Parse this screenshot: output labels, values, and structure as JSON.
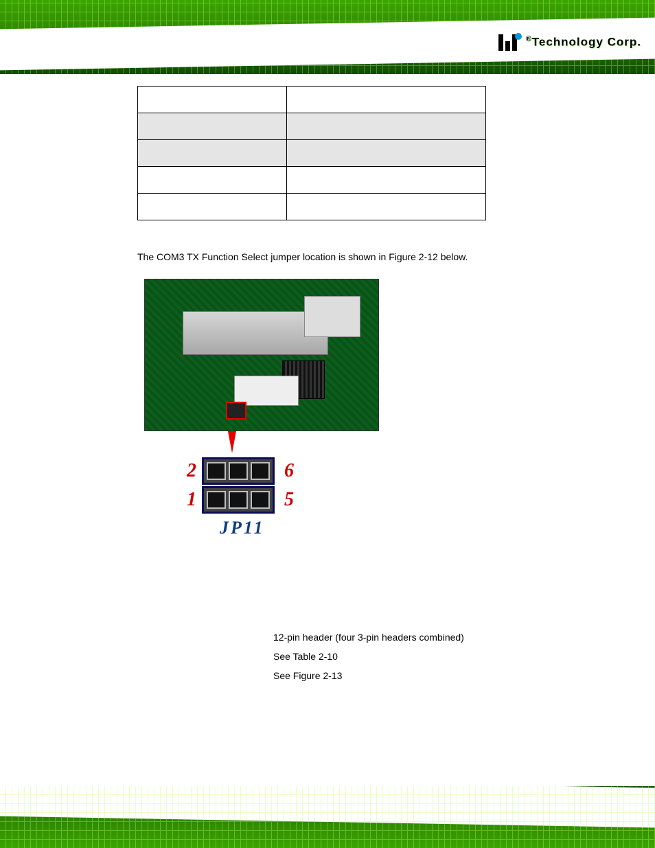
{
  "header": {
    "brand_text": "Technology Corp.",
    "registered": "®"
  },
  "table_rows": [
    {
      "shade": false,
      "left": "",
      "right": ""
    },
    {
      "shade": true,
      "left": "",
      "right": ""
    },
    {
      "shade": true,
      "left": "",
      "right": ""
    },
    {
      "shade": false,
      "left": "",
      "right": ""
    },
    {
      "shade": false,
      "left": "",
      "right": ""
    }
  ],
  "body_text": "The COM3 TX Function Select jumper location is shown in Figure 2-12 below.",
  "jumper": {
    "pin_top_left": "2",
    "pin_top_right": "6",
    "pin_bot_left": "1",
    "pin_bot_right": "5",
    "label": "JP11"
  },
  "list": {
    "item1": "12-pin header (four 3-pin headers combined)",
    "item2": "See Table 2-10",
    "item3": "See Figure 2-13"
  }
}
